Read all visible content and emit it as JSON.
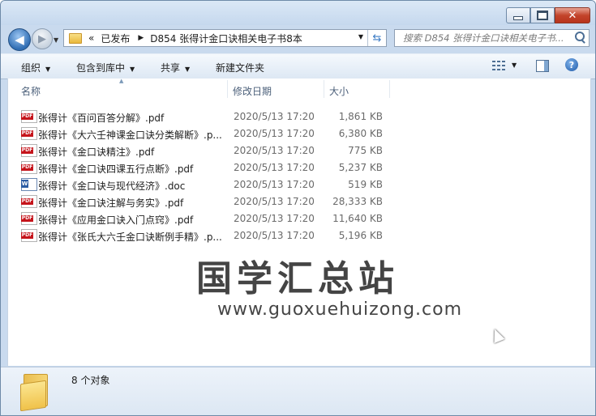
{
  "window": {
    "caption_buttons": {
      "minimize_icon": "minimize-icon",
      "maximize_icon": "maximize-icon",
      "close_icon": "close-icon"
    }
  },
  "nav": {
    "back_icon": "back-arrow-icon",
    "forward_icon": "forward-arrow-icon",
    "breadcrumb_overflow": "«",
    "breadcrumbs": [
      "已发布",
      "D854 张得计金口诀相关电子书8本"
    ],
    "search_placeholder": "搜索 D854 张得计金口诀相关电子书..."
  },
  "toolbar": {
    "organize": "组织",
    "include_in_library": "包含到库中",
    "share": "共享",
    "new_folder": "新建文件夹"
  },
  "columns": {
    "name": "名称",
    "date_modified": "修改日期",
    "size": "大小"
  },
  "files": [
    {
      "type": "pdf",
      "icon": "pdf-file-icon",
      "name": "张得计《百问百答分解》.pdf",
      "date": "2020/5/13 17:20",
      "size": "1,861 KB"
    },
    {
      "type": "pdf",
      "icon": "pdf-file-icon",
      "name": "张得计《大六壬神课金口诀分类解断》.p...",
      "date": "2020/5/13 17:20",
      "size": "6,380 KB"
    },
    {
      "type": "pdf",
      "icon": "pdf-file-icon",
      "name": "张得计《金口诀精注》.pdf",
      "date": "2020/5/13 17:20",
      "size": "775 KB"
    },
    {
      "type": "pdf",
      "icon": "pdf-file-icon",
      "name": "张得计《金口诀四课五行点断》.pdf",
      "date": "2020/5/13 17:20",
      "size": "5,237 KB"
    },
    {
      "type": "doc",
      "icon": "word-file-icon",
      "name": "张得计《金口诀与现代经济》.doc",
      "date": "2020/5/13 17:20",
      "size": "519 KB"
    },
    {
      "type": "pdf",
      "icon": "pdf-file-icon",
      "name": "张得计《金口诀注解与务实》.pdf",
      "date": "2020/5/13 17:20",
      "size": "28,333 KB"
    },
    {
      "type": "pdf",
      "icon": "pdf-file-icon",
      "name": "张得计《应用金口诀入门点窍》.pdf",
      "date": "2020/5/13 17:20",
      "size": "11,640 KB"
    },
    {
      "type": "pdf",
      "icon": "pdf-file-icon",
      "name": "张得计《张氏大六壬金口诀断例手精》.p...",
      "date": "2020/5/13 17:20",
      "size": "5,196 KB"
    }
  ],
  "watermark": {
    "title": "国学汇总站",
    "url": "www.guoxuehuizong.com"
  },
  "status": {
    "count": "8 个对象"
  }
}
